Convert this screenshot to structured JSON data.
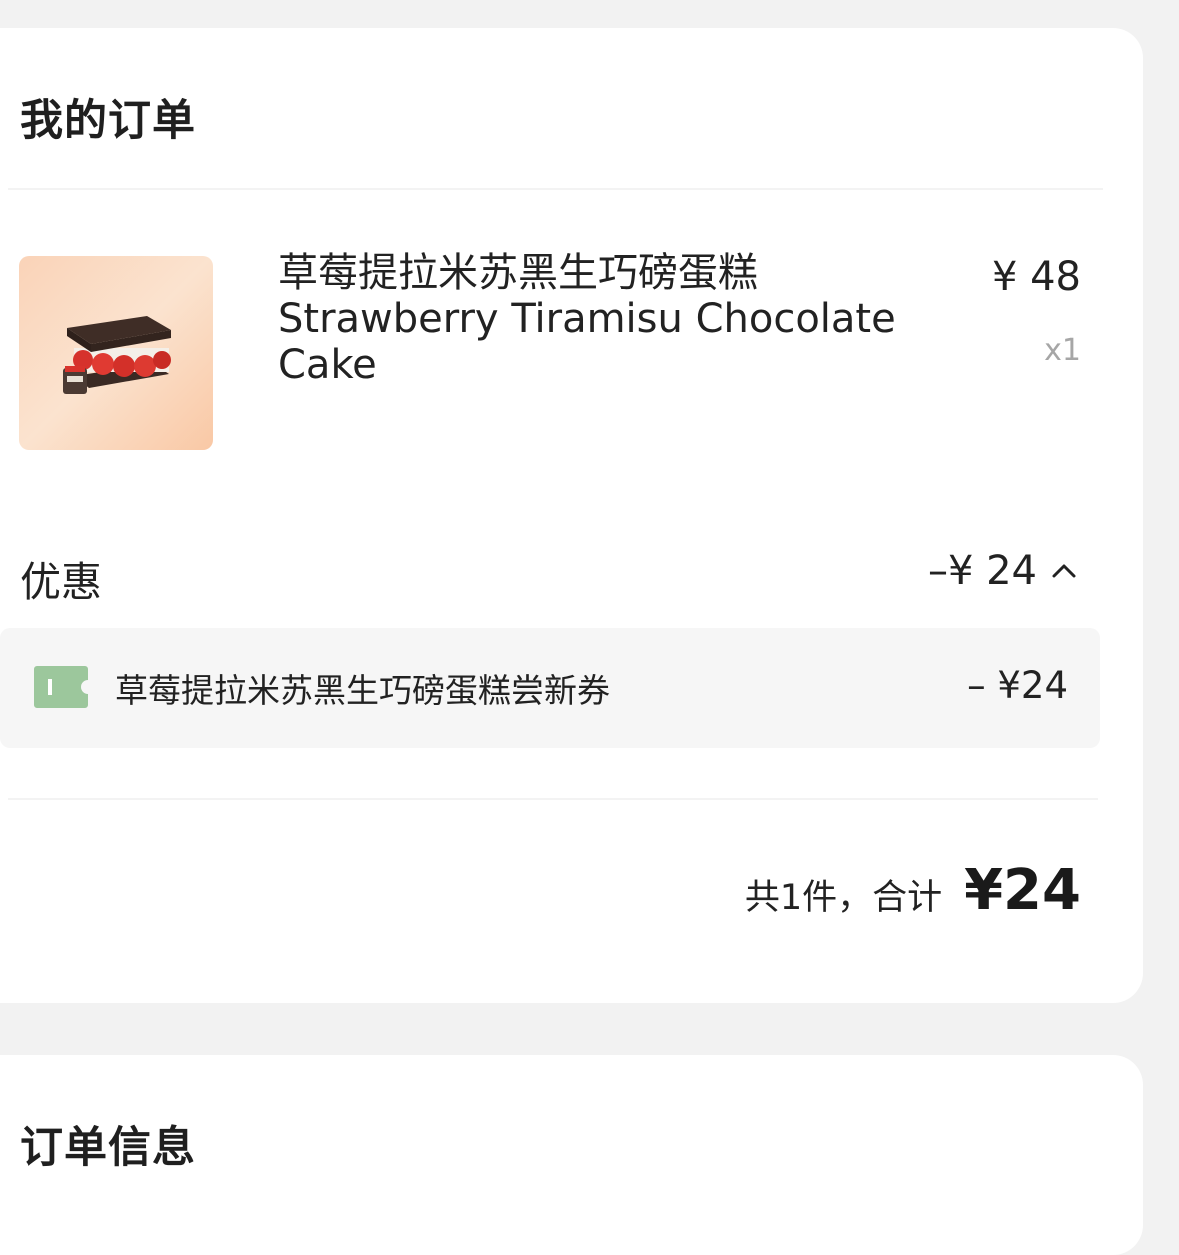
{
  "order": {
    "title": "我的订单",
    "item": {
      "name_cn": "草莓提拉米苏黑生巧磅蛋糕",
      "name_en": "Strawberry Tiramisu Chocolate Cake",
      "price": "¥ 48",
      "quantity": "x1",
      "image_icon": "cake-image"
    },
    "discount": {
      "label": "优惠",
      "amount": "–¥ 24",
      "toggle_icon": "chevron-up-icon"
    },
    "coupon": {
      "icon": "coupon-icon",
      "name": "草莓提拉米苏黑生巧磅蛋糕尝新券",
      "amount": "– ¥24",
      "icon_color": "#9cc79c"
    },
    "summary": {
      "count_text": "共1件，合计",
      "total": "¥24"
    }
  },
  "order_info": {
    "title": "订单信息"
  }
}
